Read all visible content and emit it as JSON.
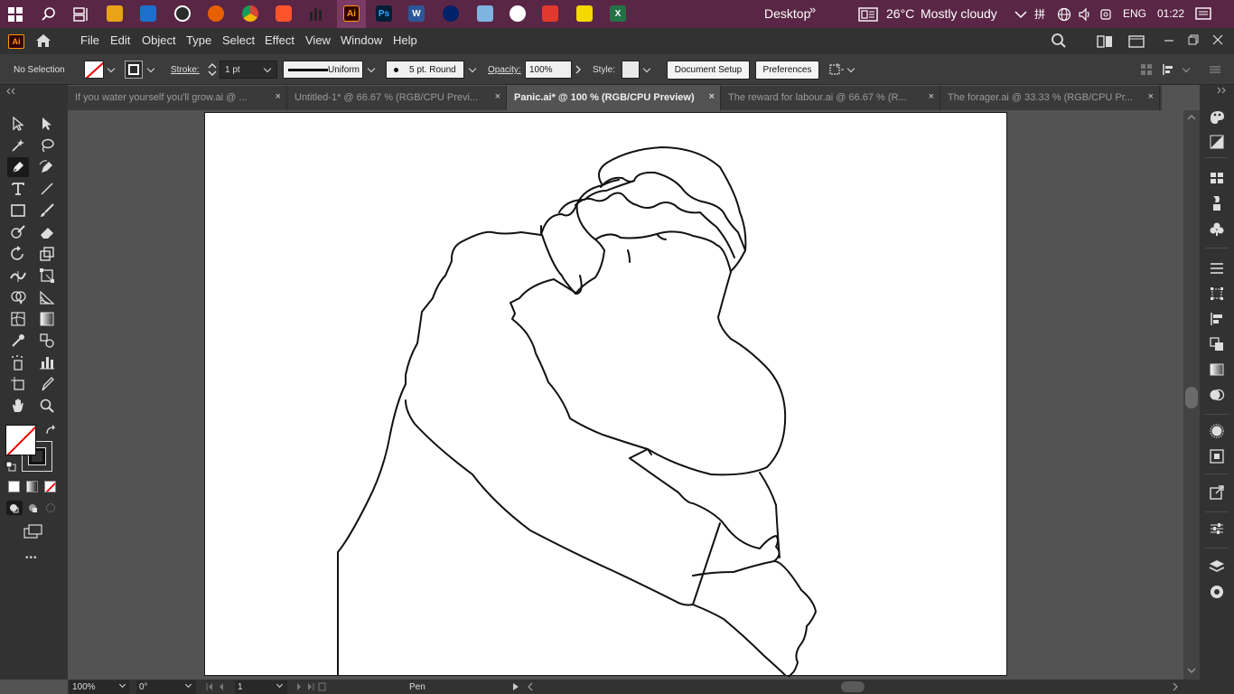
{
  "taskbar": {
    "desktop_label": "Desktop",
    "overflow_glyph": "»",
    "temperature": "26°C",
    "weather": "Mostly cloudy",
    "ime_glyph": "拼",
    "language": "ENG",
    "time": "01:22",
    "apps": {
      "illustrator": "Ai",
      "photoshop": "Ps",
      "word": "W",
      "excel": "X"
    }
  },
  "menubar": {
    "app_logo": "Ai",
    "items": [
      "File",
      "Edit",
      "Object",
      "Type",
      "Select",
      "Effect",
      "View",
      "Window",
      "Help"
    ]
  },
  "controlbar": {
    "selection": "No Selection",
    "stroke_label": "Stroke:",
    "stroke_weight": "1 pt",
    "stroke_profile": "Uniform",
    "brush": "5 pt. Round",
    "opacity_label": "Opacity:",
    "opacity_value": "100%",
    "style_label": "Style:",
    "document_setup": "Document Setup",
    "preferences": "Preferences"
  },
  "tabs": [
    {
      "label": "If you water yourself you'll grow.ai @ ...",
      "active": false
    },
    {
      "label": "Untitled-1* @ 66.67 % (RGB/CPU Previ...",
      "active": false
    },
    {
      "label": "Panic.ai* @ 100 % (RGB/CPU Preview)",
      "active": true
    },
    {
      "label": "The reward for labour.ai @ 66.67 % (R...",
      "active": false
    },
    {
      "label": "The forager.ai @ 33.33 % (RGB/CPU Pr...",
      "active": false
    }
  ],
  "tab_close_glyph": "×",
  "toolbar_more": "•••",
  "statusbar": {
    "zoom": "100%",
    "rotation": "0°",
    "artboard_number": "1",
    "current_tool": "Pen"
  },
  "colors": {
    "taskbar_bg": "#5a2645",
    "panel_bg": "#323232",
    "canvas_bg": "#535353",
    "artboard_bg": "#ffffff"
  }
}
